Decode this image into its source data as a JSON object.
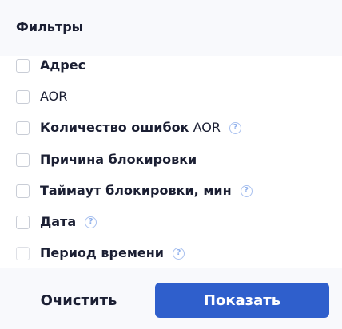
{
  "header": {
    "title": "Фильтры"
  },
  "filters": [
    {
      "bold": "Адрес",
      "plain": "",
      "help": false
    },
    {
      "bold": "",
      "plain": "AOR",
      "help": false
    },
    {
      "bold": "Количество ошибок",
      "plain": "AOR",
      "help": true
    },
    {
      "bold": "Причина блокировки",
      "plain": "",
      "help": false
    },
    {
      "bold": "Таймаут блокировки, мин",
      "plain": "",
      "help": true
    },
    {
      "bold": "Дата",
      "plain": "",
      "help": true
    },
    {
      "bold": "Период времени",
      "plain": "",
      "help": true
    }
  ],
  "help_glyph": "?",
  "footer": {
    "clear_label": "Очистить",
    "show_label": "Показать"
  },
  "colors": {
    "accent": "#2f5fcc",
    "help": "#8fb0ec",
    "text": "#1b1f33",
    "header_bg": "#f8f9fc"
  }
}
